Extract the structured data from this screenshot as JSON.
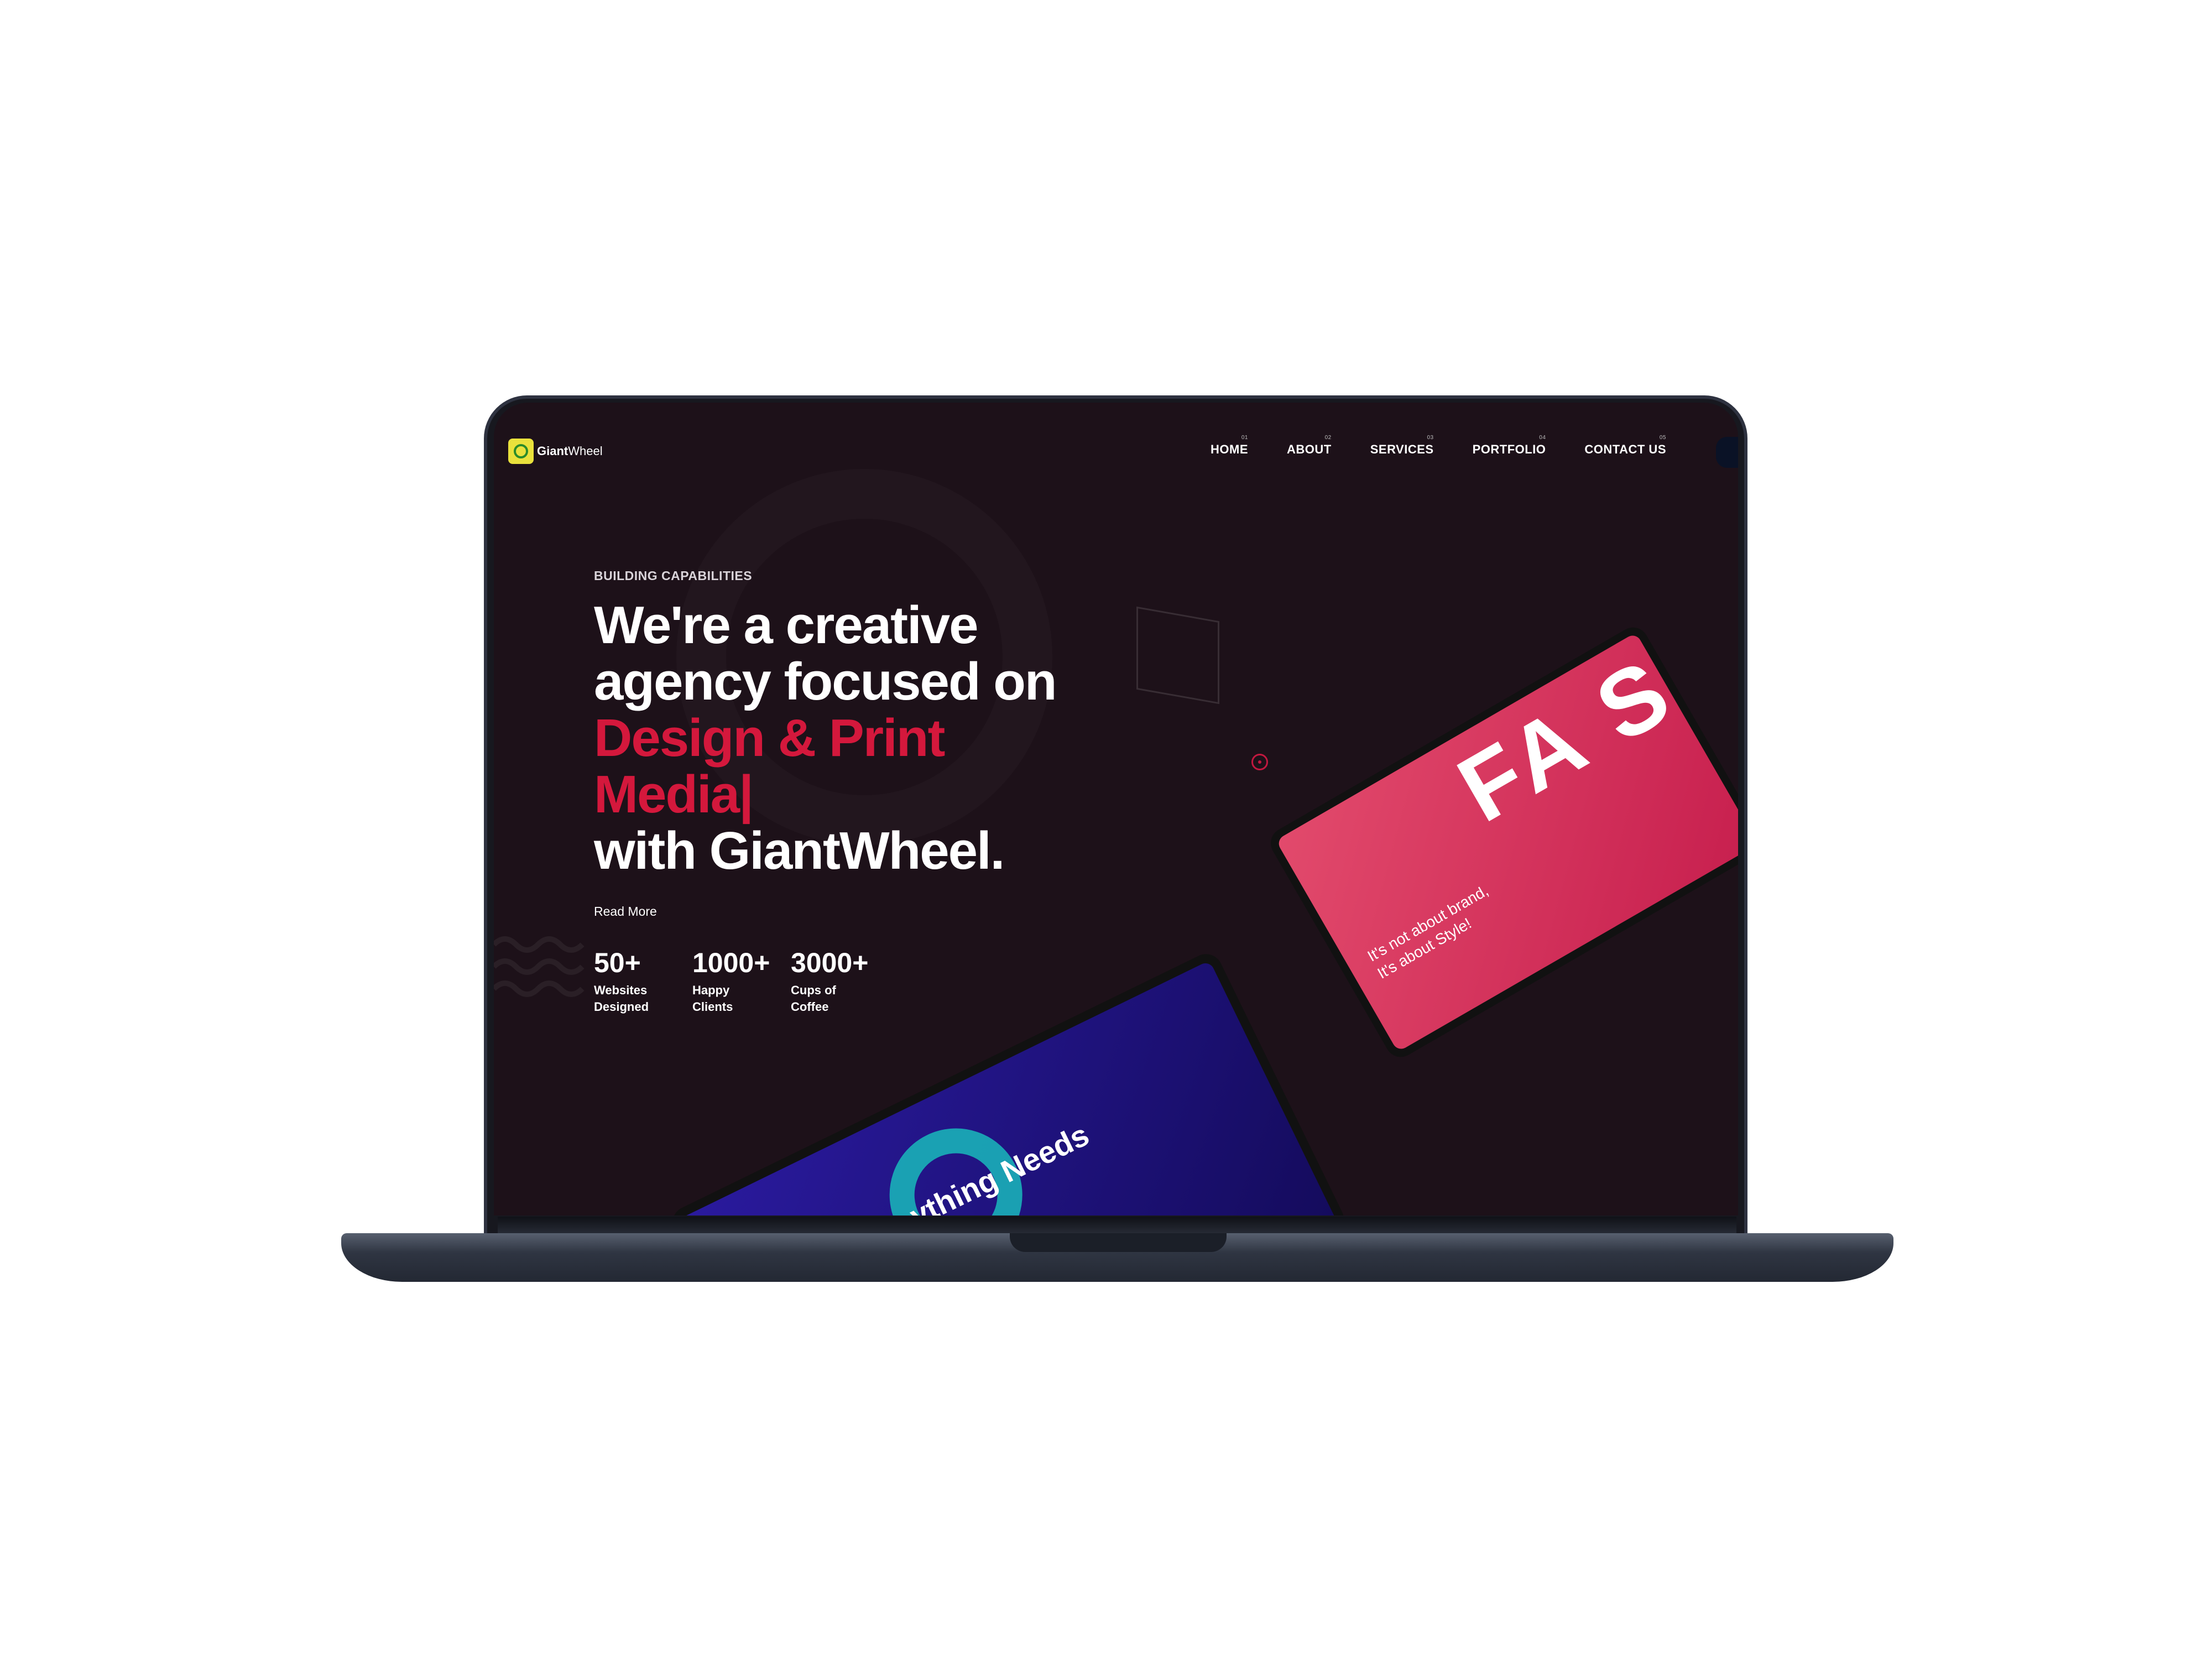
{
  "brand": {
    "name_bold": "Giant",
    "name_light": "Wheel"
  },
  "nav": [
    {
      "num": "01",
      "label": "HOME"
    },
    {
      "num": "02",
      "label": "ABOUT"
    },
    {
      "num": "03",
      "label": "SERVICES"
    },
    {
      "num": "04",
      "label": "PORTFOLIO"
    },
    {
      "num": "05",
      "label": "CONTACT US"
    }
  ],
  "hero": {
    "eyebrow": "BUILDING CAPABILITIES",
    "line1": "We're a creative",
    "line2": "agency focused on",
    "highlight1": "Design & Print",
    "highlight2": "Media|",
    "line3": "with GiantWheel.",
    "read_more": "Read More"
  },
  "stats": [
    {
      "value": "50+",
      "label1": "Websites",
      "label2": "Designed"
    },
    {
      "value": "1000+",
      "label1": "Happy",
      "label2": "Clients"
    },
    {
      "value": "3000+",
      "label1": "Cups of",
      "label2": "Coffee"
    }
  ],
  "mockups": {
    "pink": {
      "big": "FA S",
      "tagline1": "It's not about brand,",
      "tagline2": "It's about Style!"
    },
    "blue": {
      "text": "ything Needs"
    }
  },
  "colors": {
    "accent": "#d4183c",
    "bg": "#1d1119"
  }
}
